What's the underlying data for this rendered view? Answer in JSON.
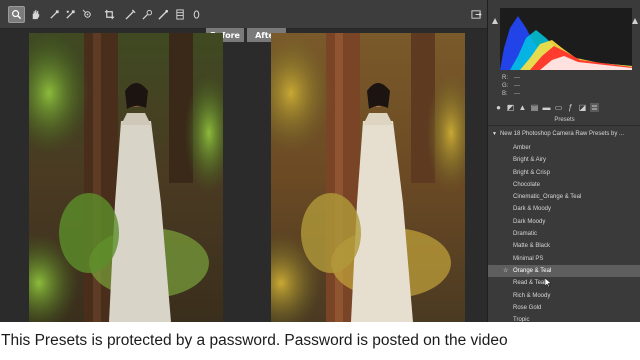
{
  "toolbar": {
    "tools": [
      "zoom-icon",
      "hand-icon",
      "white-balance-icon",
      "color-sampler-icon",
      "target-adjust-icon",
      "crop-icon",
      "straighten-icon",
      "spot-removal-icon",
      "red-eye-icon",
      "adjustment-brush-icon",
      "graduated-filter-icon",
      "radial-filter-icon"
    ],
    "open_preferences": "open-preferences-icon"
  },
  "compare": {
    "before_label": "Before",
    "after_label": "After"
  },
  "panel": {
    "rgb": {
      "r_label": "R:",
      "g_label": "G:",
      "b_label": "B:",
      "r_value": "---",
      "g_value": "---",
      "b_value": "---"
    },
    "tab_icons": [
      "basic-icon",
      "tone-curve-icon",
      "detail-icon",
      "hsl-icon",
      "split-toning-icon",
      "lens-icon",
      "effects-icon",
      "calibration-icon",
      "presets-icon",
      "snapshots-icon"
    ],
    "presets_title": "Presets",
    "folder_name": "New 18 Photoshop Camera Raw Presets by ...",
    "presets": [
      "Amber",
      "Bright & Airy",
      "Bright & Crisp",
      "Chocolate",
      "Cinematic_Orange & Teal",
      "Dark & Moody",
      "Dark Moody",
      "Dramatic",
      "Matte & Black",
      "Minimal PS",
      "Orange & Teal",
      "Read & Teal",
      "Rich & Moody",
      "Rose Gold",
      "Tropic"
    ],
    "selected_preset": "Orange & Teal"
  },
  "caption": {
    "text": "This Presets is protected by a password. Password is posted on the video"
  },
  "colors": {
    "toolbar_bg": "#3d3d3d",
    "panel_bg": "#3a3a3a",
    "workspace_bg": "#2b2b2b",
    "selected_row": "#5e5e5e",
    "caption_bg": "#ffffff"
  }
}
